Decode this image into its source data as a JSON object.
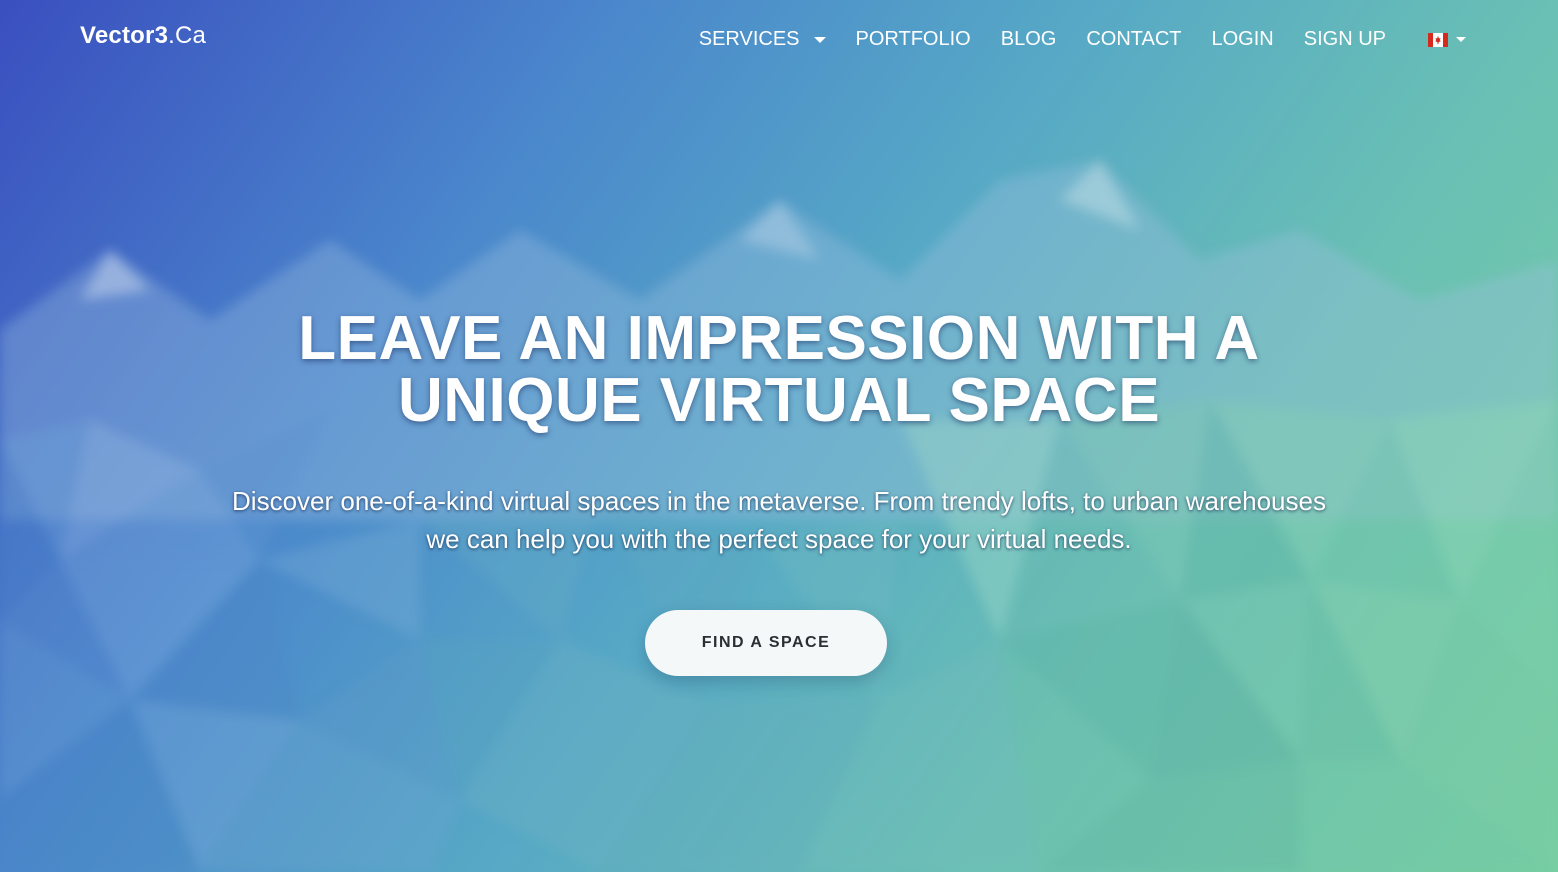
{
  "navbar": {
    "brand_bold": "Vector3",
    "brand_light": ".Ca",
    "links": [
      {
        "label": "SERVICES",
        "has_dropdown": true
      },
      {
        "label": "PORTFOLIO"
      },
      {
        "label": "BLOG"
      },
      {
        "label": "CONTACT"
      },
      {
        "label": "LOGIN"
      },
      {
        "label": "SIGN UP"
      }
    ],
    "language": {
      "flag_icon": "canada-flag-icon",
      "has_dropdown": true
    }
  },
  "hero": {
    "title_line1": "LEAVE AN IMPRESSION WITH A",
    "title_line2": "UNIQUE VIRTUAL SPACE",
    "subtitle": "Discover one-of-a-kind virtual spaces in the metaverse. From trendy lofts, to urban warehouses we can help you with the perfect space for your virtual needs.",
    "cta_label": "FIND A SPACE"
  },
  "colors": {
    "gradient_start": "#3a4fbf",
    "gradient_mid": "#56a8c6",
    "gradient_end": "#77cfa0",
    "button_bg": "#f4f8f9",
    "button_text": "#2b2f33",
    "text": "#ffffff"
  }
}
